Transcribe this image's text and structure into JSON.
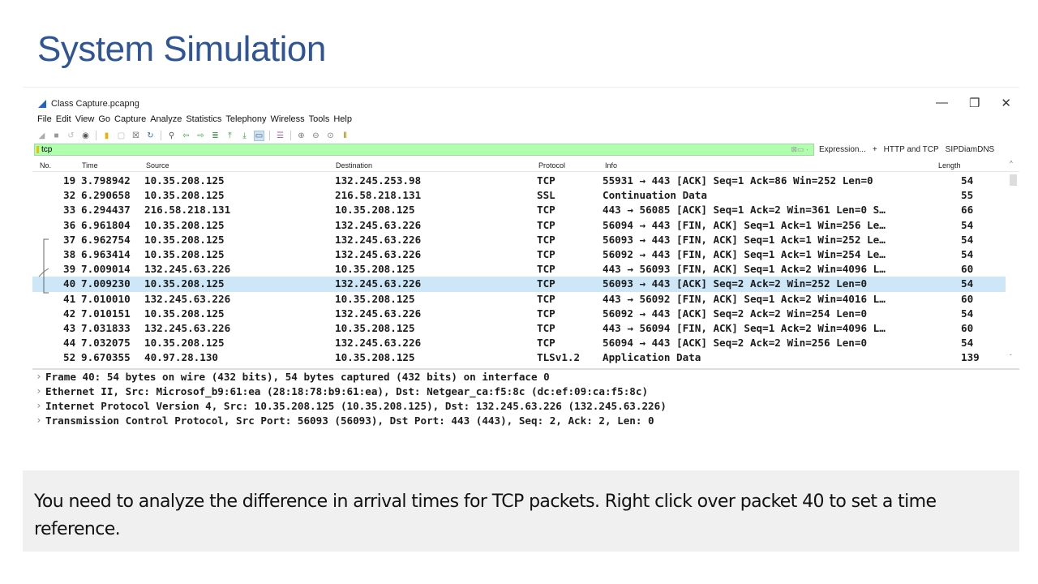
{
  "slide": {
    "title": "System Simulation",
    "caption": "You need to analyze the difference in arrival times for TCP packets. Right click over packet 40 to set a time reference."
  },
  "window": {
    "title": "Class Capture.pcapng",
    "controls": {
      "minimize": "—",
      "restore": "❐",
      "close": "✕"
    }
  },
  "menu": [
    "File",
    "Edit",
    "View",
    "Go",
    "Capture",
    "Analyze",
    "Statistics",
    "Telephony",
    "Wireless",
    "Tools",
    "Help"
  ],
  "toolbar": {
    "icons": [
      "shark-fin-start-icon",
      "stop-icon",
      "restart-icon",
      "options-gear-icon",
      "open-folder-icon",
      "save-icon",
      "close-file-icon",
      "reload-icon",
      "find-packet-icon",
      "go-back-icon",
      "go-forward-icon",
      "go-to-packet-icon",
      "first-packet-icon",
      "last-packet-icon",
      "autoscroll-icon",
      "colorize-icon",
      "zoom-in-icon",
      "zoom-out-icon",
      "normal-size-icon",
      "resize-columns-icon"
    ]
  },
  "filter": {
    "value": "tcp",
    "expression_label": "Expression...",
    "plus_label": "+",
    "buttons": [
      "HTTP and TCP",
      "SIPDiamDNS"
    ]
  },
  "columns": [
    "No.",
    "Time",
    "Source",
    "Destination",
    "Protocol",
    "Info",
    "Length"
  ],
  "packets": [
    {
      "no": "19",
      "time": "3.798942",
      "src": "10.35.208.125",
      "dst": "132.245.253.98",
      "proto": "TCP",
      "info": "55931 → 443 [ACK] Seq=1 Ack=86 Win=252 Len=0",
      "len": "54"
    },
    {
      "no": "32",
      "time": "6.290658",
      "src": "10.35.208.125",
      "dst": "216.58.218.131",
      "proto": "SSL",
      "info": "Continuation Data",
      "len": "55"
    },
    {
      "no": "33",
      "time": "6.294437",
      "src": "216.58.218.131",
      "dst": "10.35.208.125",
      "proto": "TCP",
      "info": "443 → 56085 [ACK] Seq=1 Ack=2 Win=361 Len=0 S…",
      "len": "66"
    },
    {
      "no": "36",
      "time": "6.961804",
      "src": "10.35.208.125",
      "dst": "132.245.63.226",
      "proto": "TCP",
      "info": "56094 → 443 [FIN, ACK] Seq=1 Ack=1 Win=256 Le…",
      "len": "54"
    },
    {
      "no": "37",
      "time": "6.962754",
      "src": "10.35.208.125",
      "dst": "132.245.63.226",
      "proto": "TCP",
      "info": "56093 → 443 [FIN, ACK] Seq=1 Ack=1 Win=252 Le…",
      "len": "54"
    },
    {
      "no": "38",
      "time": "6.963414",
      "src": "10.35.208.125",
      "dst": "132.245.63.226",
      "proto": "TCP",
      "info": "56092 → 443 [FIN, ACK] Seq=1 Ack=1 Win=254 Le…",
      "len": "54"
    },
    {
      "no": "39",
      "time": "7.009014",
      "src": "132.245.63.226",
      "dst": "10.35.208.125",
      "proto": "TCP",
      "info": "443 → 56093 [FIN, ACK] Seq=1 Ack=2 Win=4096 L…",
      "len": "60"
    },
    {
      "no": "40",
      "time": "7.009230",
      "src": "10.35.208.125",
      "dst": "132.245.63.226",
      "proto": "TCP",
      "info": "56093 → 443 [ACK] Seq=2 Ack=2 Win=252 Len=0",
      "len": "54",
      "selected": true
    },
    {
      "no": "41",
      "time": "7.010010",
      "src": "132.245.63.226",
      "dst": "10.35.208.125",
      "proto": "TCP",
      "info": "443 → 56092 [FIN, ACK] Seq=1 Ack=2 Win=4016 L…",
      "len": "60"
    },
    {
      "no": "42",
      "time": "7.010151",
      "src": "10.35.208.125",
      "dst": "132.245.63.226",
      "proto": "TCP",
      "info": "56092 → 443 [ACK] Seq=2 Ack=2 Win=254 Len=0",
      "len": "54"
    },
    {
      "no": "43",
      "time": "7.031833",
      "src": "132.245.63.226",
      "dst": "10.35.208.125",
      "proto": "TCP",
      "info": "443 → 56094 [FIN, ACK] Seq=1 Ack=2 Win=4096 L…",
      "len": "60"
    },
    {
      "no": "44",
      "time": "7.032075",
      "src": "10.35.208.125",
      "dst": "132.245.63.226",
      "proto": "TCP",
      "info": "56094 → 443 [ACK] Seq=2 Ack=2 Win=256 Len=0",
      "len": "54"
    },
    {
      "no": "52",
      "time": "9.670355",
      "src": "40.97.28.130",
      "dst": "10.35.208.125",
      "proto": "TLSv1.2",
      "info": "Application Data",
      "len": "139"
    }
  ],
  "details": [
    "Frame 40: 54 bytes on wire (432 bits), 54 bytes captured (432 bits) on interface 0",
    "Ethernet II, Src: Microsof_b9:61:ea (28:18:78:b9:61:ea), Dst: Netgear_ca:f5:8c (dc:ef:09:ca:f5:8c)",
    "Internet Protocol Version 4, Src: 10.35.208.125 (10.35.208.125), Dst: 132.245.63.226 (132.245.63.226)",
    "Transmission Control Protocol, Src Port: 56093 (56093), Dst Port: 443 (443), Seq: 2, Ack: 2, Len: 0"
  ]
}
